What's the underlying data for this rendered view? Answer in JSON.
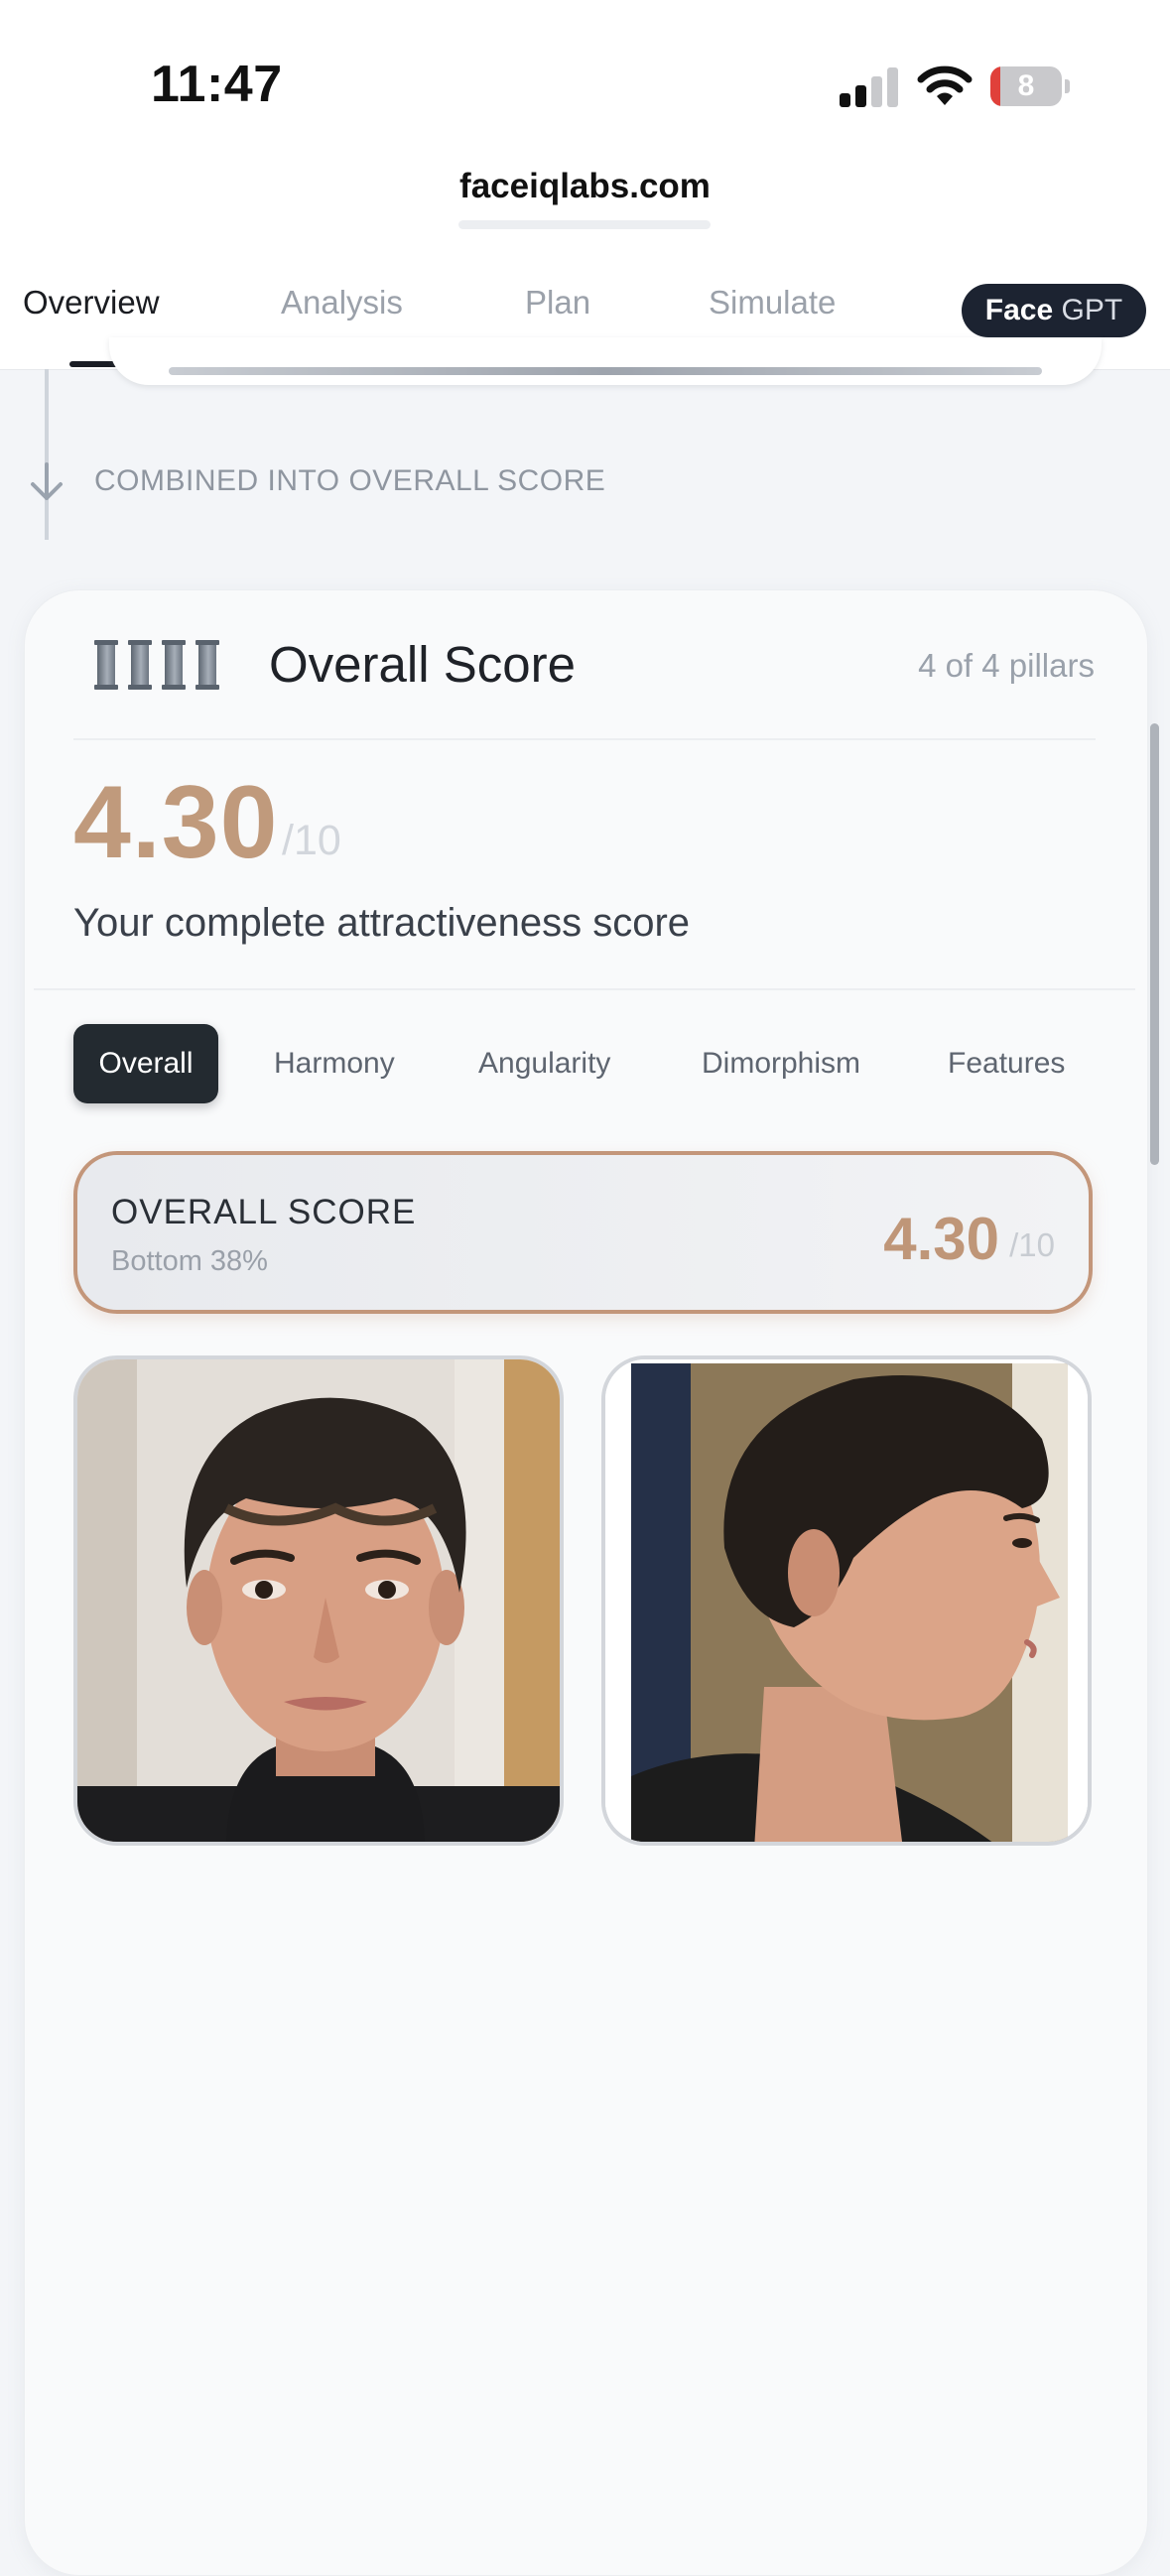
{
  "status_bar": {
    "time": "11:47",
    "battery_level": "8",
    "battery_fraction": 0.08,
    "signal_bars_active": 2,
    "icons": [
      "signal-icon",
      "wifi-icon",
      "battery-icon"
    ]
  },
  "browser": {
    "url": "faceiqlabs.com"
  },
  "tabs": [
    {
      "label": "Overview",
      "active": true
    },
    {
      "label": "Analysis",
      "active": false
    },
    {
      "label": "Plan",
      "active": false
    },
    {
      "label": "Simulate",
      "active": false
    }
  ],
  "facegpt": {
    "label_strong": "Face",
    "label_light": "GPT"
  },
  "connector": {
    "label": "COMBINED INTO OVERALL SCORE",
    "icon": "arrow-down-icon"
  },
  "overall_card": {
    "title": "Overall Score",
    "icon": "pillars-icon",
    "pillars_count": "4 of 4 pillars",
    "score": "4.30",
    "score_denominator": "/10",
    "subtitle": "Your complete attractiveness score"
  },
  "category_tabs": [
    {
      "label": "Overall",
      "active": true
    },
    {
      "label": "Harmony",
      "active": false
    },
    {
      "label": "Angularity",
      "active": false
    },
    {
      "label": "Dimorphism",
      "active": false
    },
    {
      "label": "Features",
      "active": false
    }
  ],
  "summary": {
    "label": "OVERALL SCORE",
    "rank": "Bottom 38%",
    "score": "4.30",
    "denominator": "/10"
  },
  "photos": [
    {
      "name": "front-photo",
      "view": "front"
    },
    {
      "name": "side-photo",
      "view": "profile"
    }
  ],
  "colors": {
    "accent": "#c09a7c",
    "dark": "#1c2331",
    "muted_text": "#9aa1ab",
    "battery_low": "#e0403a"
  }
}
